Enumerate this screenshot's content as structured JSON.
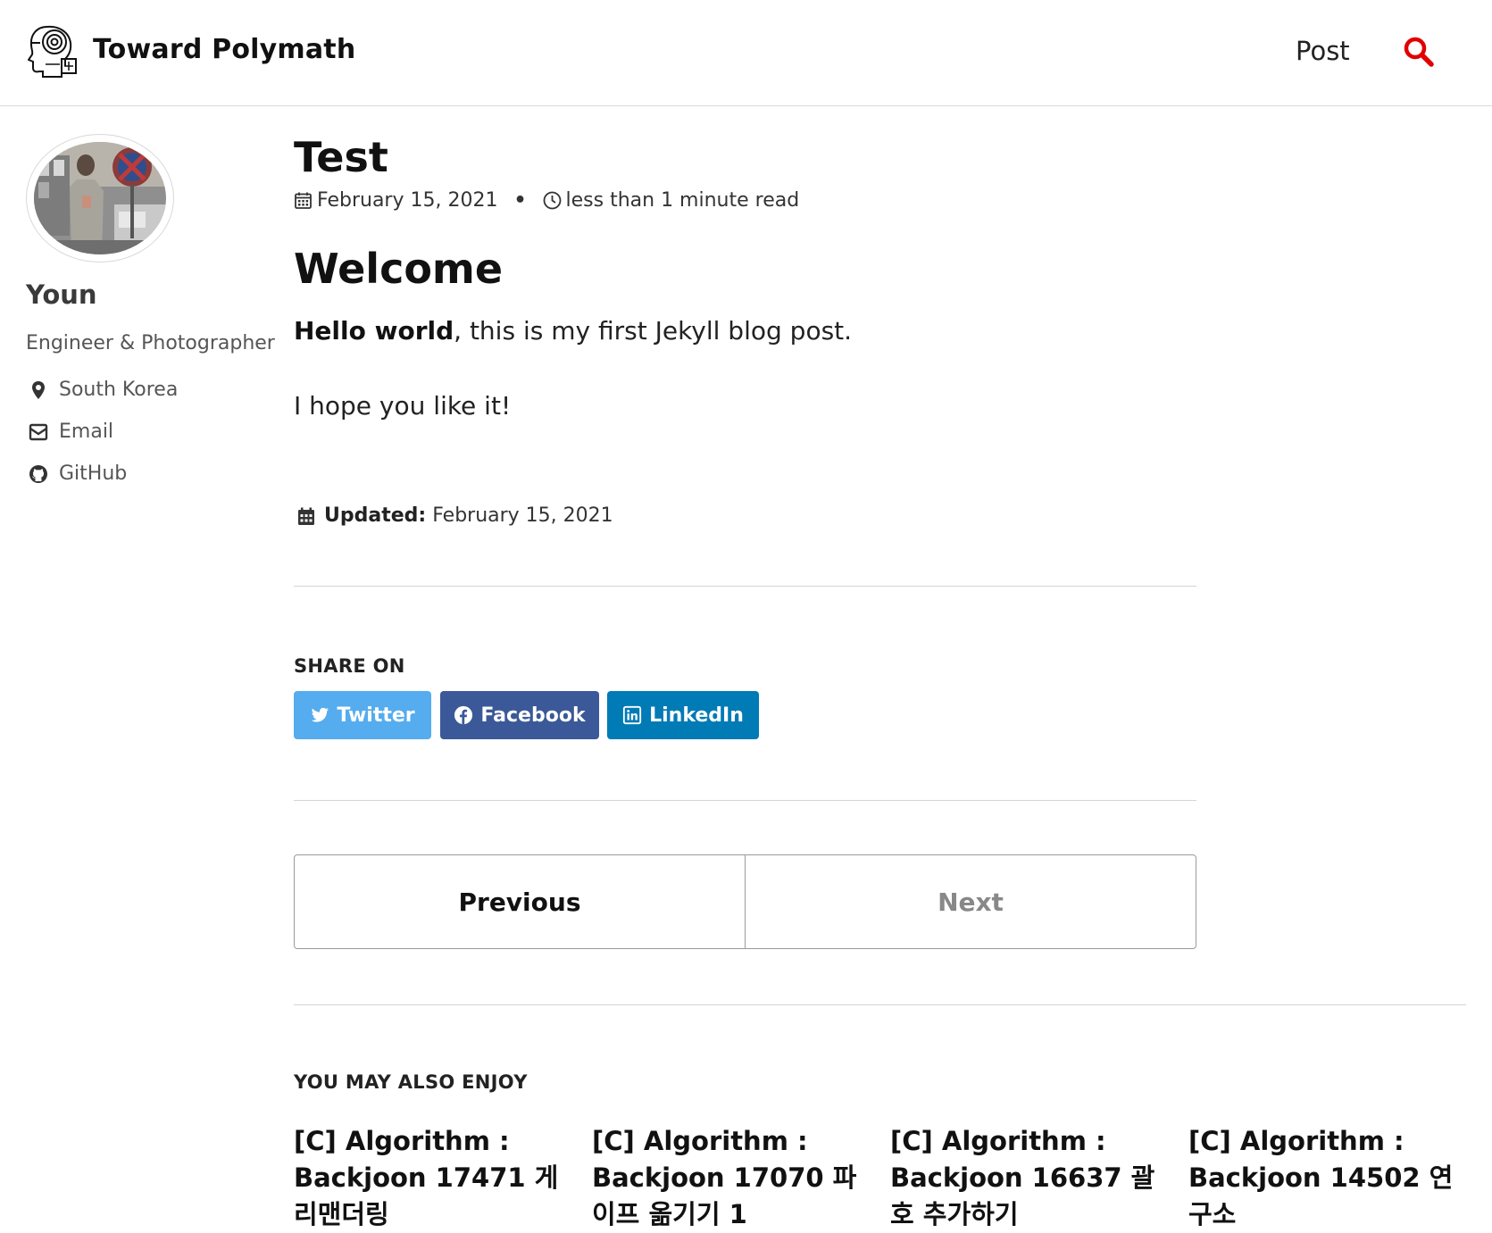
{
  "header": {
    "site_title": "Toward Polymath",
    "nav_post": "Post",
    "search_icon": "search-icon"
  },
  "sidebar": {
    "author_name": "Youn",
    "author_bio": "Engineer & Photographer",
    "links": [
      {
        "label": "South Korea",
        "icon": "map-marker-icon"
      },
      {
        "label": "Email",
        "icon": "envelope-icon"
      },
      {
        "label": "GitHub",
        "icon": "github-icon"
      }
    ]
  },
  "post": {
    "title": "Test",
    "date": "February 15, 2021",
    "separator": "•",
    "read_time": "less than 1 minute read",
    "heading": "Welcome",
    "para1_bold": "Hello world",
    "para1_rest": ", this is my first Jekyll blog post.",
    "para2": "I hope you like it!",
    "updated_label": "Updated:",
    "updated_date": "February 15, 2021"
  },
  "share": {
    "title": "SHARE ON",
    "twitter": "Twitter",
    "facebook": "Facebook",
    "linkedin": "LinkedIn",
    "colors": {
      "twitter": "#55acee",
      "facebook": "#3b5998",
      "linkedin": "#007bb6"
    }
  },
  "pager": {
    "previous": "Previous",
    "next": "Next"
  },
  "related": {
    "title": "YOU MAY ALSO ENJOY",
    "items": [
      "[C] Algorithm : Backjoon 17471 게리맨더링",
      "[C] Algorithm : Backjoon 17070 파이프 옮기기 1",
      "[C] Algorithm : Backjoon 16637 괄호 추가하기",
      "[C] Algorithm : Backjoon 14502 연구소"
    ]
  },
  "colors": {
    "accent_red": "#e10000",
    "rule": "#d4d4d4"
  }
}
